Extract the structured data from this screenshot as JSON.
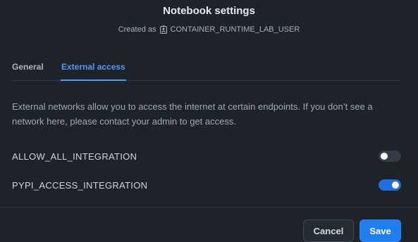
{
  "dialog": {
    "title": "Notebook settings",
    "created_as_prefix": "Created as",
    "created_as_user": "CONTAINER_RUNTIME_LAB_USER",
    "user_icon": "user-badge-icon"
  },
  "tabs": [
    {
      "label": "General",
      "active": false
    },
    {
      "label": "External access",
      "active": true
    }
  ],
  "description": "External networks allow you to access the internet at certain endpoints. If you don’t see a network here, please contact your admin to get access.",
  "integrations": [
    {
      "name": "ALLOW_ALL_INTEGRATION",
      "enabled": false
    },
    {
      "name": "PYPI_ACCESS_INTEGRATION",
      "enabled": true
    }
  ],
  "footer": {
    "cancel_label": "Cancel",
    "save_label": "Save"
  },
  "colors": {
    "background": "#1e232a",
    "accent": "#4a9df8",
    "toggle_on": "#1f6fe0",
    "primary_button": "#1f7ff0"
  }
}
